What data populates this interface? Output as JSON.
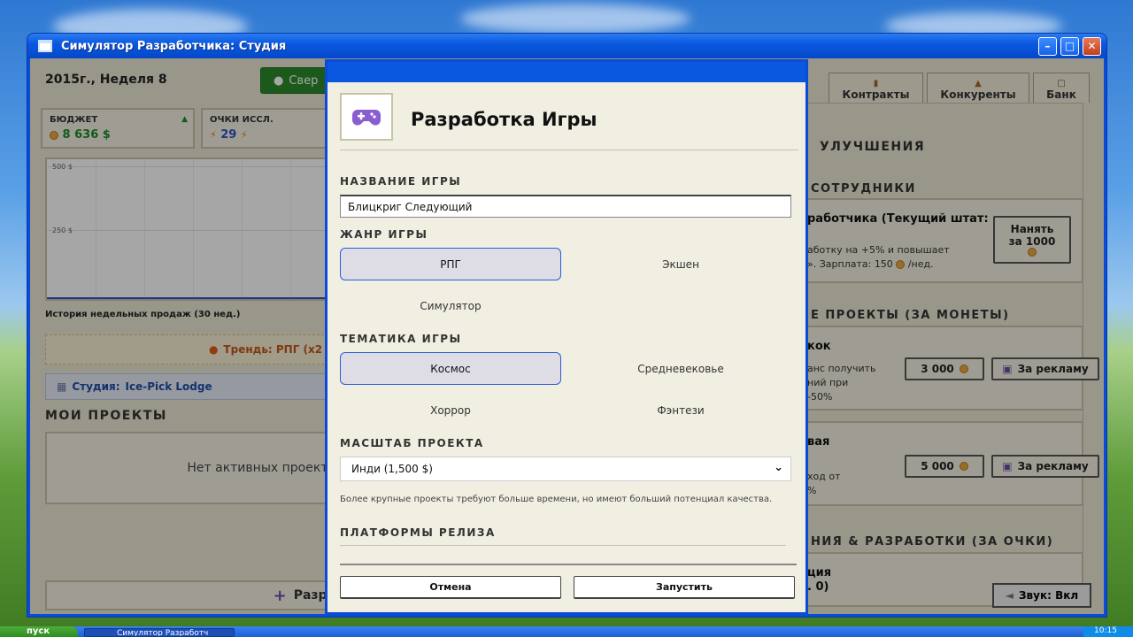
{
  "window": {
    "title": "Симулятор Разработчика: Студия"
  },
  "header": {
    "date": "2015г., Неделя 8",
    "green_button": "Свер"
  },
  "stats": [
    {
      "label": "БЮДЖЕТ",
      "value": "8 636 $",
      "color": "#1e8a2a"
    },
    {
      "label": "ОЧКИ ИССЛ.",
      "value": "29",
      "color": "#2a55c8"
    }
  ],
  "chart": {
    "caption": "История недельных продаж (30 нед.)",
    "y_ticks": [
      "500 $",
      "250 $"
    ]
  },
  "trend": "Трендь: РПГ (x2 д",
  "studio": {
    "label": "Студия:",
    "name": "Ice-Pick Lodge"
  },
  "my_projects": {
    "title": "МОИ ПРОЕКТЫ",
    "empty": "Нет активных проекто"
  },
  "bottom_button": "Разра",
  "tabs": [
    {
      "label": "Контракты"
    },
    {
      "label": "Конкуренты"
    },
    {
      "label": "Банк"
    }
  ],
  "right": {
    "upgrades_title": "УЛУЧШЕНИЯ",
    "staff_title": "СОТРУДНИКИ",
    "hire_title": "работчика (Текущий штат:",
    "hire_desc_1": "аботку на +5% и повышает",
    "hire_desc_2": "». Зарплата: 150",
    "hire_desc_3": "/нед.",
    "hire_button_1": "Нанять",
    "hire_button_2": "за 1000",
    "coin_projects_title": "Е ПРОЕКТЫ (ЗА МОНЕТЫ)",
    "card1_title": "кок",
    "card1_l1": "анс получить",
    "card1_l2": "ний при",
    "card1_l3": "-50%",
    "card1_price": "3 000",
    "card1_ad": "За рекламу",
    "card2_title": "вая",
    "card2_l1": "ход от",
    "card2_l2": "%",
    "card2_price": "5 000",
    "card2_ad": "За рекламу",
    "research_title": "НИЯ & РАЗРАБОТКИ (ЗА ОЧКИ)",
    "card3_l1": "ция",
    "card3_l2": ". 0)"
  },
  "sound_button": "Звук: Вкл",
  "modal": {
    "title": "Разработка Игры",
    "name_label": "НАЗВАНИЕ ИГРЫ",
    "name_value": "Блицкриг Следующий",
    "genre_label": "ЖАНР ИГРЫ",
    "genres": [
      "РПГ",
      "Экшен",
      "Симулятор"
    ],
    "theme_label": "ТЕМАТИКА ИГРЫ",
    "themes": [
      "Космос",
      "Средневековье",
      "Хоррор",
      "Фэнтези"
    ],
    "scale_label": "МАСШТАБ ПРОЕКТА",
    "scale_value": "Инди (1,500 $)",
    "scale_hint": "Более крупные проекты требуют больше времени, но имеют больший потенциал качества.",
    "platforms_label": "ПЛАТФОРМЫ РЕЛИЗА",
    "cancel": "Отмена",
    "launch": "Запустить"
  },
  "taskbar": {
    "start": "пуск",
    "item": "Симулятор Разработч",
    "clock": "10:15"
  }
}
